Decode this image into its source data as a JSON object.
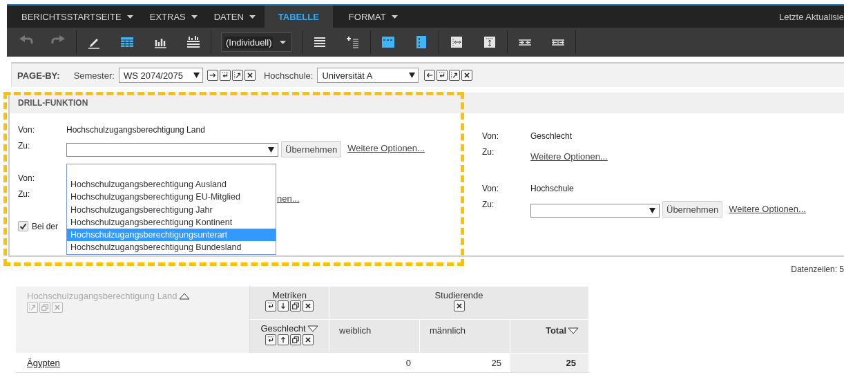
{
  "menu": {
    "items": [
      {
        "label": "BERICHTSSTARTSEITE",
        "caret": true,
        "selected": false
      },
      {
        "label": "EXTRAS",
        "caret": true,
        "selected": false
      },
      {
        "label": "DATEN",
        "caret": true,
        "selected": false
      },
      {
        "label": "TABELLE",
        "caret": false,
        "selected": true
      },
      {
        "label": "FORMAT",
        "caret": true,
        "selected": false
      }
    ],
    "status_text": "Letzte Aktualisie"
  },
  "toolbar": {
    "groups": [
      [
        {
          "kind": "undo",
          "active": false,
          "disabled": true
        },
        {
          "kind": "redo",
          "active": false,
          "disabled": true
        }
      ],
      [
        {
          "kind": "pencil",
          "active": false,
          "disabled": false
        },
        {
          "kind": "grid",
          "active": true,
          "disabled": false
        },
        {
          "kind": "bars",
          "active": false,
          "disabled": false
        },
        {
          "kind": "grid-chart",
          "active": false,
          "disabled": false
        }
      ],
      [
        {
          "kind": "select",
          "value": "(Individuell)"
        }
      ],
      [
        {
          "kind": "lines",
          "active": false,
          "disabled": false
        },
        {
          "kind": "add-lines",
          "active": false,
          "disabled": false
        }
      ],
      [
        {
          "kind": "col-header",
          "active": true,
          "disabled": false
        },
        {
          "kind": "row-header",
          "active": true,
          "disabled": false
        }
      ],
      [
        {
          "kind": "fit-width",
          "active": false,
          "disabled": false
        },
        {
          "kind": "fit-height",
          "active": false,
          "disabled": false
        }
      ],
      [
        {
          "kind": "merge",
          "active": false,
          "disabled": false
        },
        {
          "kind": "split",
          "active": false,
          "disabled": false
        }
      ]
    ]
  },
  "page_by": {
    "label": "PAGE-BY:",
    "filters": [
      {
        "label": "Semester:",
        "value": "WS 2074/2075"
      },
      {
        "label": "Hochschule:",
        "value": "Universität A"
      }
    ]
  },
  "drill": {
    "title": "DRILL-FUNKTION",
    "columns": [
      [
        {
          "kind": "select",
          "von_label": "Von:",
          "von_value": "Hochschulzugangsberechtigung Land",
          "zu_label": "Zu:",
          "button": "Übernehmen",
          "link": "Weitere Optionen..."
        },
        {
          "kind": "covered",
          "von_label": "Von:",
          "zu_label": "Zu:",
          "link": "nen..."
        }
      ],
      [
        {
          "kind": "link-only",
          "von_label": "Von:",
          "von_value": "Geschlecht",
          "zu_label": "Zu:",
          "link": "Weitere Optionen..."
        },
        {
          "kind": "select",
          "von_label": "Von:",
          "von_value": "Hochschule",
          "zu_label": "Zu:",
          "button": "Übernehmen",
          "link": "Weitere Optionen..."
        }
      ]
    ],
    "checkbox": {
      "label": "Bei der",
      "checked": true
    },
    "open_list": {
      "options": [
        {
          "label": "Hochschulzugangsberechtigung Ausland",
          "selected": false
        },
        {
          "label": "Hochschulzugangsberechtigung EU-Mitglied",
          "selected": false
        },
        {
          "label": "Hochschulzugangsberechtigung Jahr",
          "selected": false
        },
        {
          "label": "Hochschulzugangsberechtigung Kontinent",
          "selected": false
        },
        {
          "label": "Hochschulzugangsberechtigungsunterart",
          "selected": true
        },
        {
          "label": "Hochschulzugangsberechtigung Bundesland",
          "selected": false
        }
      ]
    }
  },
  "data_rows_text": "Datenzeilen: 5",
  "table": {
    "row_header": {
      "label": "Hochschulzugangsberechtigung Land"
    },
    "metrics_label": "Metriken",
    "metric": "Studierende",
    "attribute": {
      "label": "Geschlecht"
    },
    "columns": [
      {
        "label": "weiblich"
      },
      {
        "label": "männlich"
      },
      {
        "label": "Total"
      }
    ],
    "rows": [
      {
        "label": "Ägypten",
        "values": [
          "0",
          "25",
          "25"
        ]
      }
    ]
  }
}
